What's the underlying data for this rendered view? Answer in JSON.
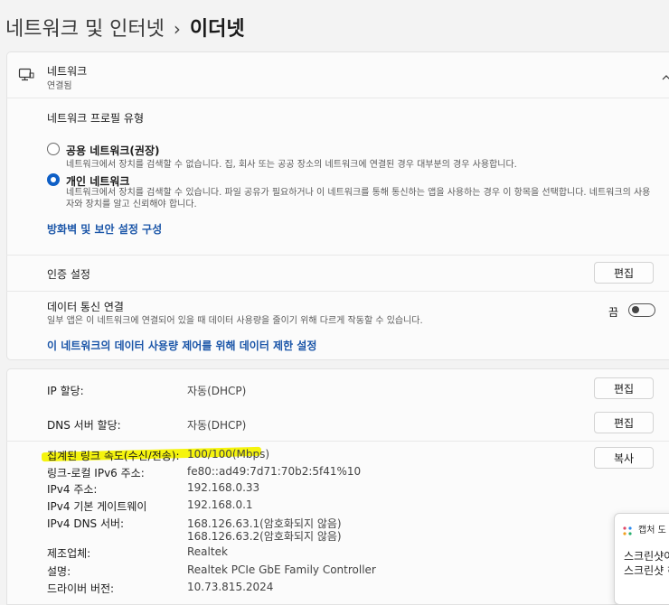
{
  "breadcrumb": {
    "parent": "네트워크 및 인터넷",
    "separator": "›",
    "current": "이더넷"
  },
  "network": {
    "title": "네트워크",
    "status": "연결됨"
  },
  "profile": {
    "heading": "네트워크 프로필 유형",
    "options": [
      {
        "label": "공용 네트워크(권장)",
        "description": "네트워크에서 장치를 검색할 수 없습니다. 집, 회사 또는 공공 장소의 네트워크에 연결된 경우 대부분의 경우 사용합니다.",
        "selected": false
      },
      {
        "label": "개인 네트워크",
        "description": "네트워크에서 장치를 검색할 수 있습니다. 파일 공유가 필요하거나 이 네트워크를 통해 통신하는 앱을 사용하는 경우 이 항목을 선택합니다. 네트워크의 사용자와 장치를 알고 신뢰해야 합니다.",
        "selected": true
      }
    ],
    "firewall_link": "방화벽 및 보안 설정 구성"
  },
  "auth": {
    "label": "인증 설정",
    "button": "편집"
  },
  "metered": {
    "label": "데이터 통신 연결",
    "description": "일부 앱은 이 네트워크에 연결되어 있을 때 데이터 사용량을 줄이기 위해 다르게 작동할 수 있습니다.",
    "state_label": "끔",
    "enabled": false,
    "limit_link": "이 네트워크의 데이터 사용량 제어를 위해 데이터 제한 설정"
  },
  "ip": {
    "label": "IP 할당:",
    "value": "자동(DHCP)",
    "button": "편집"
  },
  "dns": {
    "label": "DNS 서버 할당:",
    "value": "자동(DHCP)",
    "button": "편집"
  },
  "properties": {
    "copy_button": "복사",
    "rows": [
      {
        "label": "집계된 링크 속도(수신/전송):",
        "value": "100/100(Mbps)"
      },
      {
        "label": "링크-로컬 IPv6 주소:",
        "value": "fe80::ad49:7d71:70b2:5f41%10"
      },
      {
        "label": "IPv4 주소:",
        "value": "192.168.0.33"
      },
      {
        "label": "IPv4 기본 게이트웨이",
        "value": "192.168.0.1"
      },
      {
        "label": "IPv4 DNS 서버:",
        "value": "168.126.63.1(암호화되지 않음)"
      },
      {
        "label": "",
        "value": "168.126.63.2(암호화되지 않음)"
      },
      {
        "label": "제조업체:",
        "value": "Realtek"
      },
      {
        "label": "설명:",
        "value": "Realtek PCIe GbE Family Controller"
      },
      {
        "label": "드라이버 버전:",
        "value": "10.73.815.2024"
      }
    ]
  },
  "popup": {
    "title": "캡처 도",
    "line1": "스크린샷이",
    "line2": "스크린샷 히"
  },
  "colors": {
    "accent": "#0e5fc6",
    "link": "#1a55a8",
    "highlight": "#f4f300"
  }
}
